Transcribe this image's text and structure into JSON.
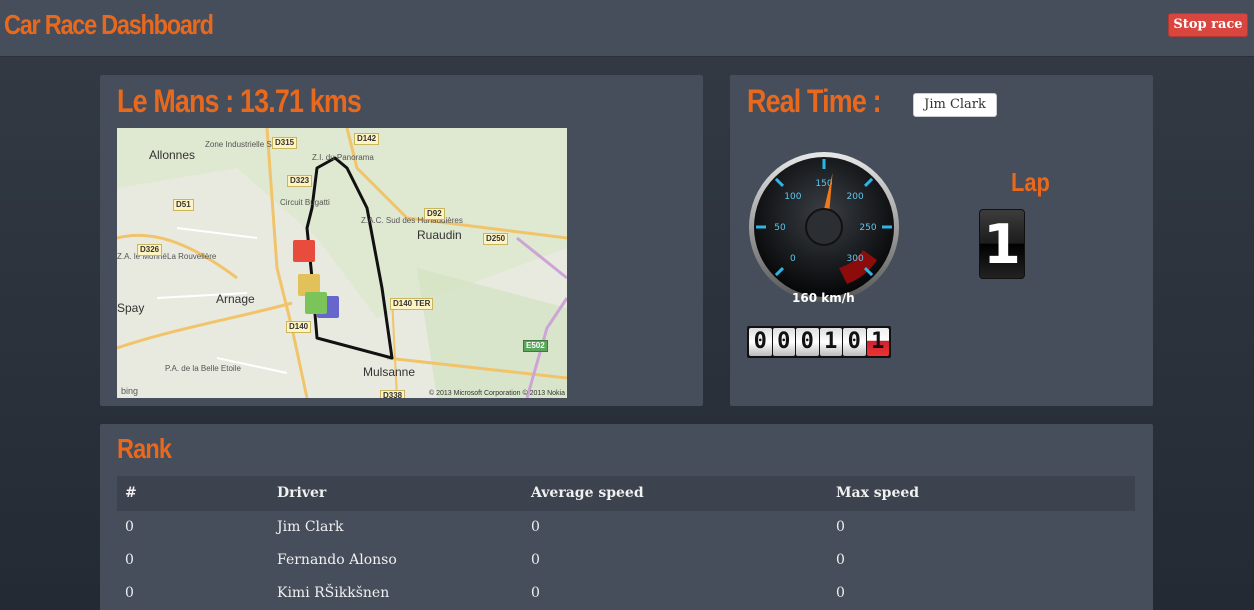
{
  "header": {
    "title": "Car Race Dashboard",
    "stop_label": "Stop race"
  },
  "track": {
    "title": "Le Mans : 13.71 kms",
    "map": {
      "places": [
        "Allonnes",
        "Arnage",
        "Ruaudin",
        "Mulsanne",
        "Spay",
        "Circuit Bugatti",
        "Z.A. le Monné",
        "La Rouvelière"
      ],
      "small_places": [
        "Zone Industrielle Sud",
        "Z.I. du Panorama",
        "Z.A.C. Sud des Hunaudières",
        "P.A. de la Belle Etoile"
      ],
      "roads": [
        "D315",
        "D142",
        "D323",
        "D51",
        "D326",
        "D92",
        "D250",
        "D140",
        "D140 TER",
        "E502",
        "D338"
      ],
      "attribution": "© 2013 Microsoft Corporation © 2013 Nokia",
      "provider": "bing"
    }
  },
  "realtime": {
    "title": "Real Time :",
    "selected_driver": "Jim Clark",
    "gauge": {
      "ticks": [
        "0",
        "50",
        "100",
        "150",
        "200",
        "250",
        "300"
      ],
      "value": 160,
      "readout": "160 km/h"
    },
    "odometer": [
      "0",
      "0",
      "0",
      "1",
      "0",
      "1"
    ],
    "lap_label": "Lap",
    "lap_value": "1"
  },
  "rank": {
    "title": "Rank",
    "columns": [
      "#",
      "Driver",
      "Average speed",
      "Max speed"
    ],
    "rows": [
      {
        "rank": "0",
        "driver": "Jim Clark",
        "avg": "0",
        "max": "0"
      },
      {
        "rank": "0",
        "driver": "Fernando Alonso",
        "avg": "0",
        "max": "0"
      },
      {
        "rank": "0",
        "driver": "Kimi RŠikkšnen",
        "avg": "0",
        "max": "0"
      }
    ]
  },
  "colors": {
    "accent": "#e8681e",
    "panel": "#454e5a",
    "danger": "#d9463f"
  }
}
